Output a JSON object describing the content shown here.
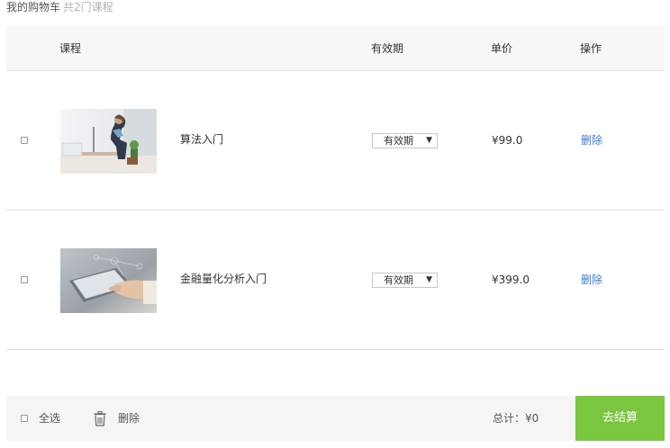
{
  "header": {
    "title": "我的购物车",
    "count_text": "共2门课程"
  },
  "table_header": {
    "course": "课程",
    "validity": "有效期",
    "price": "单价",
    "action": "操作"
  },
  "items": [
    {
      "name": "算法入门",
      "validity": "有效期",
      "price": "¥99.0",
      "delete_label": "删除",
      "image": "woman-at-desk-with-laptop"
    },
    {
      "name": "金融量化分析入门",
      "validity": "有效期",
      "price": "¥399.0",
      "delete_label": "删除",
      "image": "hand-holding-tablet"
    }
  ],
  "footer": {
    "select_all": "全选",
    "delete": "删除",
    "total": "总计：¥0",
    "checkout": "去结算"
  },
  "colors": {
    "checkout_bg": "#7bc63f",
    "link": "#3a7bd5",
    "header_bg": "#f7f7f7"
  },
  "icons": {
    "delete": "trash-icon",
    "dropdown": "triangle-down-icon"
  }
}
